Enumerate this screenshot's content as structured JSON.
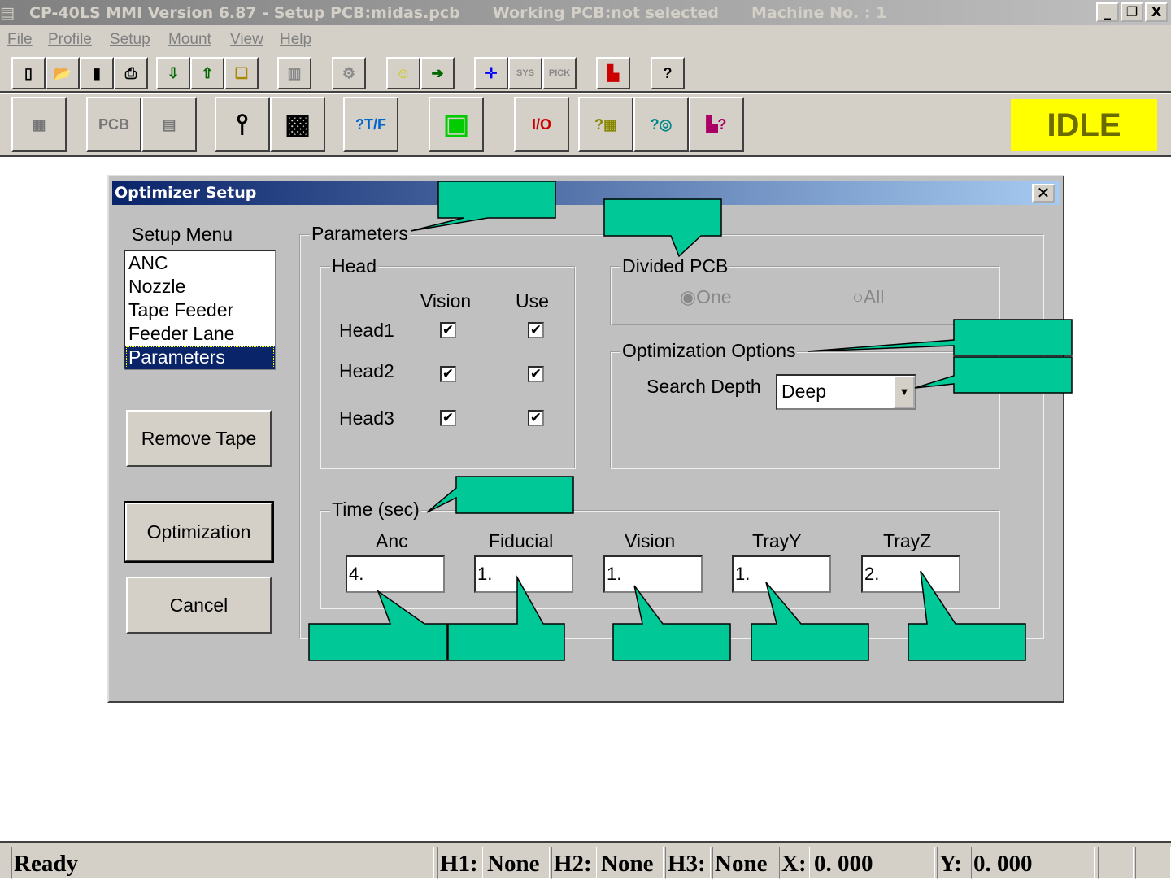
{
  "window": {
    "title": "CP-40LS MMI Version 6.87 - Setup PCB:midas.pcb",
    "working_pcb": "Working PCB:not selected",
    "machine": "Machine No. : 1",
    "min": "_",
    "restore": "❐",
    "close": "X"
  },
  "menu": [
    "File",
    "Profile",
    "Setup",
    "Mount",
    "View",
    "Help"
  ],
  "toolbar1": [
    "new",
    "open",
    "save",
    "print",
    "import",
    "export",
    "copy",
    "book",
    "tools",
    "smiley",
    "exit",
    "cross",
    "SYS",
    "PICK",
    "chart",
    "?"
  ],
  "toolbar2": [
    "component",
    "PCB",
    "feeder",
    "nozzle",
    "head",
    "T/F",
    "monitor",
    "io",
    "tray",
    "reel",
    "graph"
  ],
  "state": "IDLE",
  "dialog": {
    "title": "Optimizer Setup",
    "close": "✕",
    "setup_menu_label": "Setup Menu",
    "setup_menu": [
      "ANC",
      "Nozzle",
      "Tape Feeder",
      "Feeder Lane",
      "Parameters"
    ],
    "selected": "Parameters",
    "buttons": {
      "remove_tape": "Remove Tape",
      "optimization": "Optimization",
      "cancel": "Cancel"
    },
    "parameters": "Parameters",
    "head": {
      "label": "Head",
      "col_vision": "Vision",
      "col_use": "Use",
      "rows": [
        {
          "name": "Head1",
          "vision": "✔",
          "use": "✔"
        },
        {
          "name": "Head2",
          "vision": "✔",
          "use": "✔"
        },
        {
          "name": "Head3",
          "vision": "✔",
          "use": "✔"
        }
      ]
    },
    "divided_pcb": {
      "label": "Divided PCB",
      "one": "One",
      "all": "All",
      "selected": "One"
    },
    "opt_options": {
      "label": "Optimization Options",
      "search_depth_label": "Search Depth",
      "search_depth": "Deep"
    },
    "time": {
      "label": "Time (sec)",
      "fields": [
        {
          "label": "Anc",
          "value": "4."
        },
        {
          "label": "Fiducial",
          "value": "1."
        },
        {
          "label": "Vision",
          "value": "1."
        },
        {
          "label": "TrayY",
          "value": "1."
        },
        {
          "label": "TrayZ",
          "value": "2."
        }
      ]
    }
  },
  "status": {
    "text": "Ready",
    "h1_label": "H1:",
    "h1": "None",
    "h2_label": "H2:",
    "h2": "None",
    "h3_label": "H3:",
    "h3": "None",
    "x_label": "X:",
    "x": "0. 000",
    "y_label": "Y:",
    "y": "0. 000"
  },
  "colors": {
    "callout": "#00c896",
    "idle": "#ffff00"
  }
}
